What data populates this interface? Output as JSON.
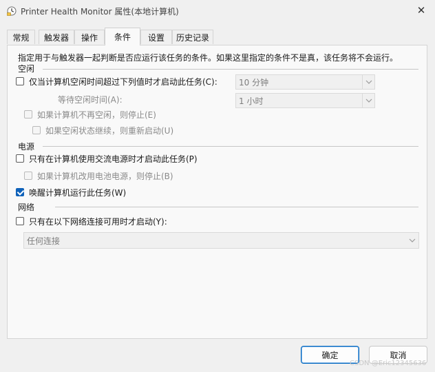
{
  "window": {
    "title": "Printer Health Monitor 属性(本地计算机)",
    "app_icon": "scheduler-clock-icon",
    "close_glyph": "✕"
  },
  "tabs": [
    {
      "label": "常规"
    },
    {
      "label": "触发器"
    },
    {
      "label": "操作"
    },
    {
      "label": "条件",
      "active": true
    },
    {
      "label": "设置"
    },
    {
      "label": "历史记录"
    }
  ],
  "conditions": {
    "intro": "指定用于与触发器一起判断是否应运行该任务的条件。如果这里指定的条件不是真，该任务将不会运行。",
    "idle": {
      "header": "空闲",
      "start_only_if_idle": {
        "label": "仅当计算机空闲时间超过下列值时才启动此任务(C):",
        "checked": false
      },
      "idle_duration": {
        "value": "10 分钟"
      },
      "wait_label": "等待空闲时间(A):",
      "wait_duration": {
        "value": "1 小时"
      },
      "stop_if_not_idle": {
        "label": "如果计算机不再空闲，则停止(E)",
        "checked": false,
        "enabled": false
      },
      "restart_if_idle_resumes": {
        "label": "如果空闲状态继续，则重新启动(U)",
        "checked": false,
        "enabled": false
      }
    },
    "power": {
      "header": "电源",
      "ac_only": {
        "label": "只有在计算机使用交流电源时才启动此任务(P)",
        "checked": false
      },
      "stop_on_battery": {
        "label": "如果计算机改用电池电源，则停止(B)",
        "checked": false,
        "enabled": false
      },
      "wake_to_run": {
        "label": "唤醒计算机运行此任务(W)",
        "checked": true
      }
    },
    "network": {
      "header": "网络",
      "network_only": {
        "label": "只有在以下网络连接可用时才启动(Y):",
        "checked": false
      },
      "connection": {
        "value": "任何连接"
      }
    }
  },
  "buttons": {
    "ok": "确定",
    "cancel": "取消"
  },
  "watermark": "CSDN @Eric12345636",
  "colors": {
    "accent": "#0f62ba",
    "disabled_text": "#8a8a8a",
    "window_bg": "#f0f0f0",
    "panel_bg": "#f9f9f9"
  }
}
